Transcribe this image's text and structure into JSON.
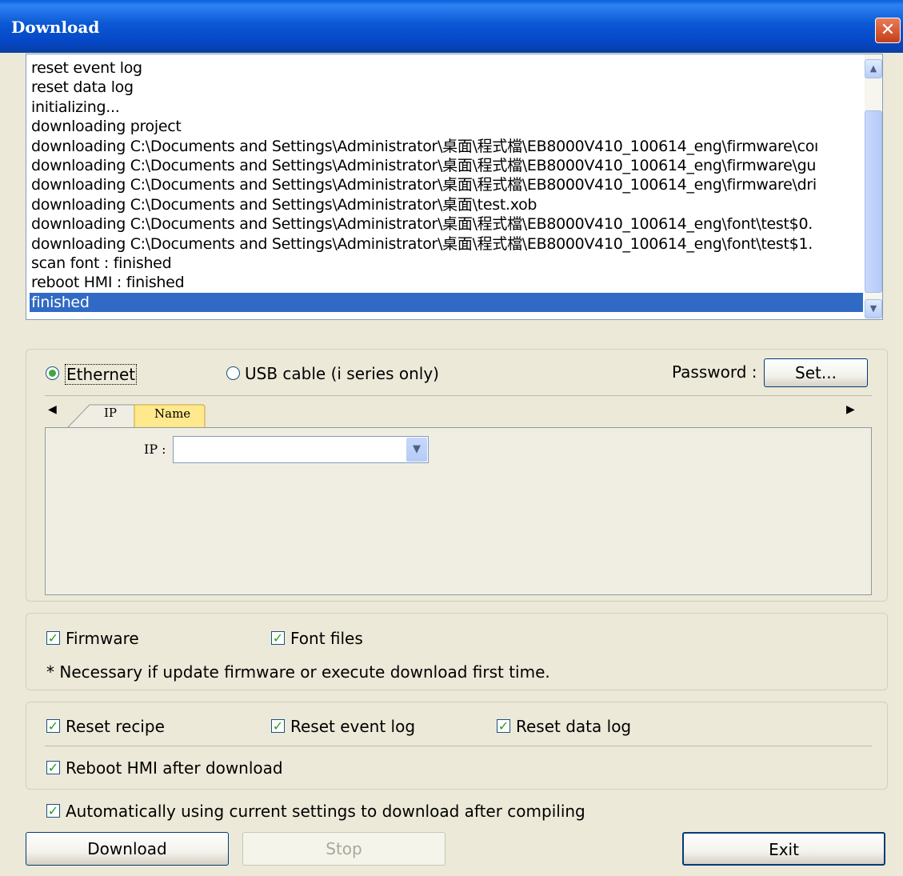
{
  "window": {
    "title": "Download",
    "close_glyph": "✕"
  },
  "log": {
    "lines": [
      "reset event log",
      "reset data log",
      "initializing...",
      "downloading project",
      "downloading C:\\Documents and Settings\\Administrator\\桌面\\程式檔\\EB8000V410_100614_eng\\firmware\\coı",
      "downloading C:\\Documents and Settings\\Administrator\\桌面\\程式檔\\EB8000V410_100614_eng\\firmware\\gu",
      "downloading C:\\Documents and Settings\\Administrator\\桌面\\程式檔\\EB8000V410_100614_eng\\firmware\\dri",
      "downloading C:\\Documents and Settings\\Administrator\\桌面\\test.xob",
      "downloading C:\\Documents and Settings\\Administrator\\桌面\\程式檔\\EB8000V410_100614_eng\\font\\test$0.",
      "downloading C:\\Documents and Settings\\Administrator\\桌面\\程式檔\\EB8000V410_100614_eng\\font\\test$1.",
      "scan font : finished",
      "reboot HMI : finished",
      "finished"
    ],
    "selected_index": 12
  },
  "connection": {
    "ethernet_label": "Ethernet",
    "usb_label": "USB cable (i series only)",
    "selected": "ethernet",
    "password_label": "Password :",
    "set_button": "Set...",
    "tabs": {
      "ip": "IP",
      "name": "Name",
      "active": "ip"
    },
    "ip_label": "IP :",
    "ip_value": ""
  },
  "firmware_group": {
    "firmware_label": "Firmware",
    "firmware_checked": true,
    "font_label": "Font files",
    "font_checked": true,
    "note": "* Necessary if update firmware or execute download first time."
  },
  "reset_group": {
    "reset_recipe": "Reset recipe",
    "reset_event_log": "Reset event log",
    "reset_data_log": "Reset data log",
    "reboot_hmi": "Reboot HMI after download"
  },
  "auto_download_label": "Automatically using current settings to download after compiling",
  "buttons": {
    "download": "Download",
    "stop": "Stop",
    "exit": "Exit"
  }
}
